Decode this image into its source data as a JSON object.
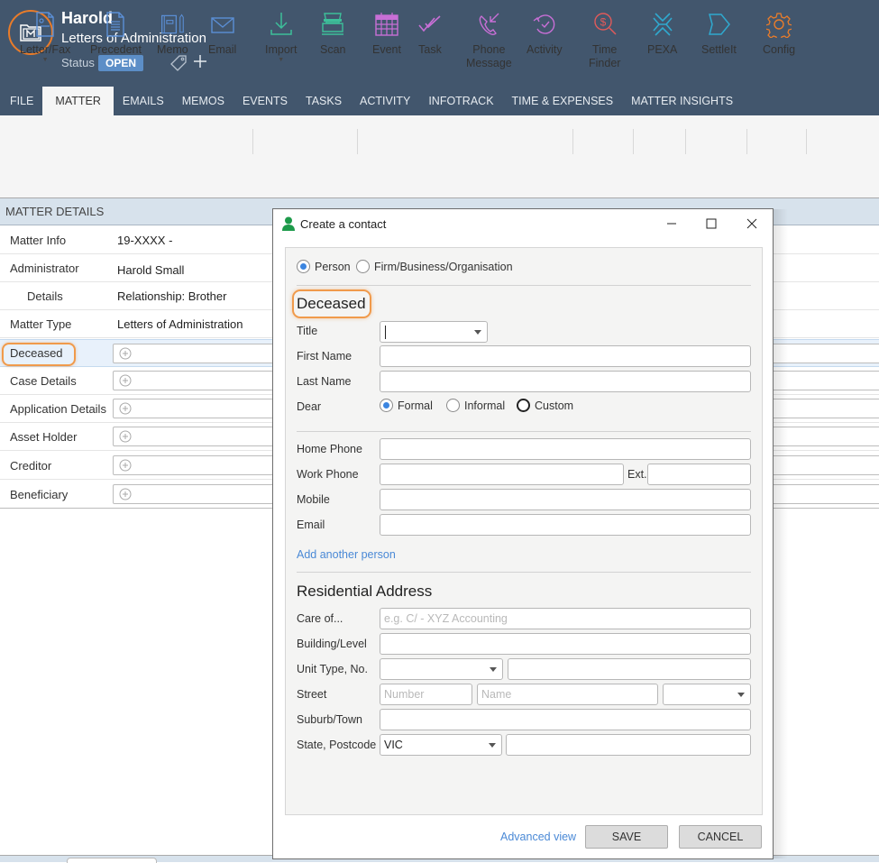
{
  "header": {
    "matter_name": "Harold",
    "matter_type": "Letters of Administration",
    "status_label": "Status",
    "status_value": "OPEN",
    "logo_icon": "matter-folder-icon",
    "accent_color": "#e97c2a"
  },
  "tabs": [
    {
      "label": "FILE",
      "active": false
    },
    {
      "label": "MATTER",
      "active": true
    },
    {
      "label": "EMAILS",
      "active": false
    },
    {
      "label": "MEMOS",
      "active": false
    },
    {
      "label": "EVENTS",
      "active": false
    },
    {
      "label": "TASKS",
      "active": false
    },
    {
      "label": "ACTIVITY",
      "active": false
    },
    {
      "label": "INFOTRACK",
      "active": false
    },
    {
      "label": "TIME & EXPENSES",
      "active": false
    },
    {
      "label": "MATTER INSIGHTS",
      "active": false
    }
  ],
  "ribbon": {
    "letter_fax": "Letter/Fax",
    "precedent": "Precedent",
    "memo": "Memo",
    "email": "Email",
    "import": "Import",
    "scan": "Scan",
    "event": "Event",
    "task": "Task",
    "phone_message_1": "Phone",
    "phone_message_2": "Message",
    "activity": "Activity",
    "time_finder_1": "Time",
    "time_finder_2": "Finder",
    "pexa": "PEXA",
    "settleit": "SettleIt",
    "config": "Config"
  },
  "matter_details": {
    "heading": "MATTER DETAILS",
    "rows": [
      {
        "key": "Matter Info",
        "value": "19-XXXX -"
      },
      {
        "key": "Administrator",
        "value": "Harold Small"
      },
      {
        "key": "Details",
        "value": "Relationship: Brother"
      },
      {
        "key": "Matter Type",
        "value": "Letters of Administration"
      },
      {
        "key": "Deceased",
        "value": ""
      },
      {
        "key": "Case Details",
        "value": ""
      },
      {
        "key": "Application Details",
        "value": ""
      },
      {
        "key": "Asset Holder",
        "value": ""
      },
      {
        "key": "Creditor",
        "value": ""
      },
      {
        "key": "Beneficiary",
        "value": ""
      }
    ]
  },
  "dialog": {
    "title": "Create a contact",
    "type_options": [
      "Person",
      "Firm/Business/Organisation"
    ],
    "type_selected": "Person",
    "section_person": "Deceased",
    "labels": {
      "title": "Title",
      "first_name": "First Name",
      "last_name": "Last Name",
      "dear": "Dear",
      "home_phone": "Home Phone",
      "work_phone": "Work Phone",
      "ext": "Ext.",
      "mobile": "Mobile",
      "email": "Email",
      "care_of": "Care of...",
      "building": "Building/Level",
      "unit": "Unit Type, No.",
      "street": "Street",
      "suburb": "Suburb/Town",
      "state_postcode": "State, Postcode"
    },
    "values": {
      "title": "",
      "first_name": "",
      "last_name": "",
      "home_phone": "",
      "work_phone": "",
      "ext": "",
      "mobile": "",
      "email": "",
      "care_of": "",
      "building": "",
      "unit_type": "",
      "unit_no": "",
      "street_number": "",
      "street_name": "",
      "street_type": "",
      "suburb": "",
      "state": "VIC",
      "postcode": ""
    },
    "placeholders": {
      "care_of": "e.g. C/ - XYZ Accounting",
      "street_number": "Number",
      "street_name": "Name"
    },
    "dear_options": [
      "Formal",
      "Informal",
      "Custom"
    ],
    "dear_selected": "Formal",
    "add_another_person": "Add another person",
    "section_address": "Residential Address",
    "advanced_view": "Advanced view",
    "save": "SAVE",
    "cancel": "CANCEL"
  }
}
